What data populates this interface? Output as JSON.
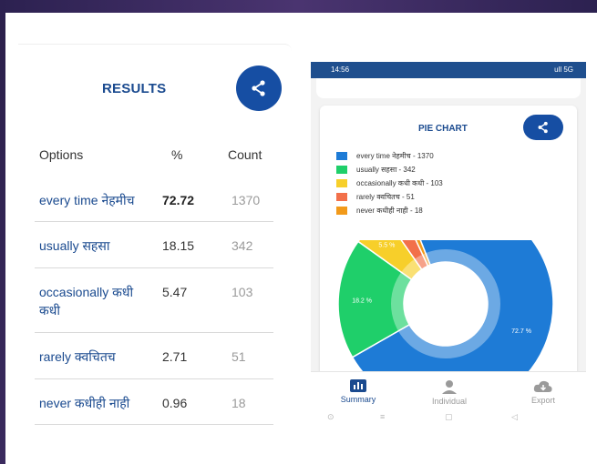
{
  "results": {
    "title": "RESULTS",
    "headers": {
      "options": "Options",
      "percent": "%",
      "count": "Count"
    },
    "rows": [
      {
        "option": "every time नेहमीच",
        "percent": "72.72",
        "count": "1370"
      },
      {
        "option": "usually सहसा",
        "percent": "18.15",
        "count": "342"
      },
      {
        "option": "occasionally कधी कधी",
        "percent": "5.47",
        "count": "103"
      },
      {
        "option": "rarely क्वचितच",
        "percent": "2.71",
        "count": "51"
      },
      {
        "option": "never कधीही नाही",
        "percent": "0.96",
        "count": "18"
      }
    ]
  },
  "phone": {
    "status_time": "14:56",
    "status_right": "ull 5G",
    "pie_title": "PIE CHART",
    "legend": [
      {
        "label": "every time नेहमीच - 1370",
        "color": "#1e7bd6"
      },
      {
        "label": "usually सहसा - 342",
        "color": "#1fcf6a"
      },
      {
        "label": "occasionally कधी कधी - 103",
        "color": "#f7cf2a"
      },
      {
        "label": "rarely क्वचितच - 51",
        "color": "#f2704a"
      },
      {
        "label": "never कधीही नाही - 18",
        "color": "#f29a1a"
      }
    ],
    "slice_labels": {
      "every_time": "72.7 %",
      "usually": "18.2 %",
      "occasionally": "5.5 %"
    },
    "nav": {
      "summary": "Summary",
      "individual": "Individual",
      "export": "Export"
    },
    "sysnav": {
      "recent": "⊙",
      "home": "≡",
      "square": "▢",
      "back": "◁"
    }
  },
  "chart_data": {
    "type": "pie",
    "title": "PIE CHART",
    "categories": [
      "every time नेहमीच",
      "usually सहसा",
      "occasionally कधी कधी",
      "rarely क्वचितच",
      "never कधीही नाही"
    ],
    "values": [
      1370,
      342,
      103,
      51,
      18
    ],
    "colors": [
      "#1e7bd6",
      "#1fcf6a",
      "#f7cf2a",
      "#f2704a",
      "#f29a1a"
    ],
    "legend": "top-left"
  }
}
